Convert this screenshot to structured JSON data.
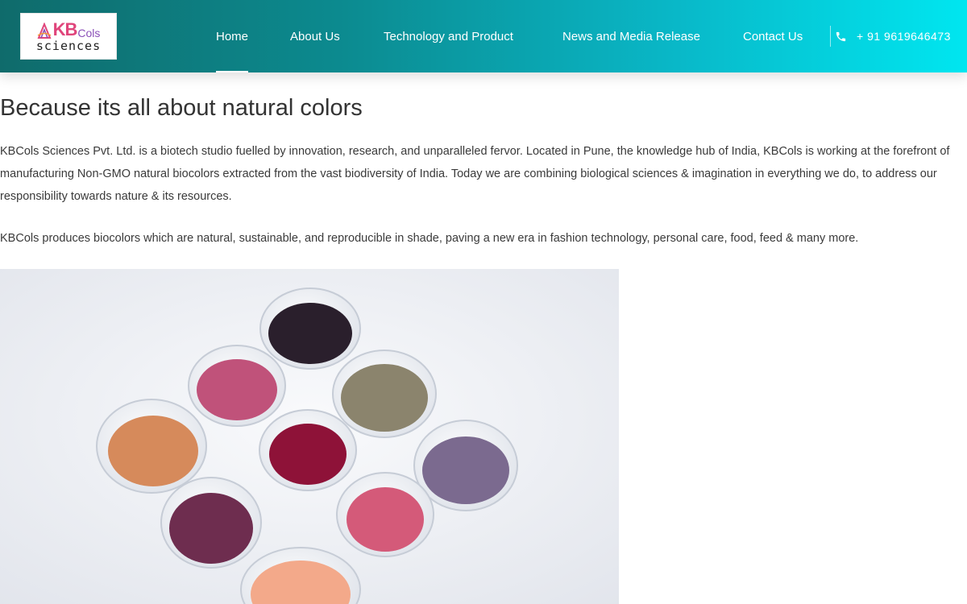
{
  "brand": {
    "logo_primary": "KB",
    "logo_secondary": "Cols",
    "logo_tagline": "sciences"
  },
  "nav": {
    "items": [
      {
        "label": "Home",
        "active": true
      },
      {
        "label": "About Us",
        "active": false
      },
      {
        "label": "Technology and Product",
        "active": false
      },
      {
        "label": "News and Media Release",
        "active": false
      },
      {
        "label": "Contact Us",
        "active": false
      }
    ],
    "phone": "+ 91 9619646473",
    "phone_icon": "phone-icon"
  },
  "content": {
    "heading": "Because its all about natural colors",
    "paragraphs": [
      "KBCols Sciences Pvt. Ltd. is a biotech studio fuelled by innovation, research, and unparalleled fervor. Located in Pune, the knowledge hub of India, KBCols is working at the forefront of manufacturing Non-GMO natural biocolors extracted from the vast biodiversity of India. Today we are combining biological sciences & imagination in everything we do, to address our responsibility towards nature & its resources.",
      "KBCols produces biocolors which are natural, sustainable, and reproducible in shade, paving a new era in fashion technology, personal care, food, feed & many more."
    ]
  },
  "colors": {
    "header_start": "#0f6b6b",
    "header_end": "#00e6f0",
    "brand_pink": "#e0457b",
    "brand_purple": "#8a4fb8"
  }
}
